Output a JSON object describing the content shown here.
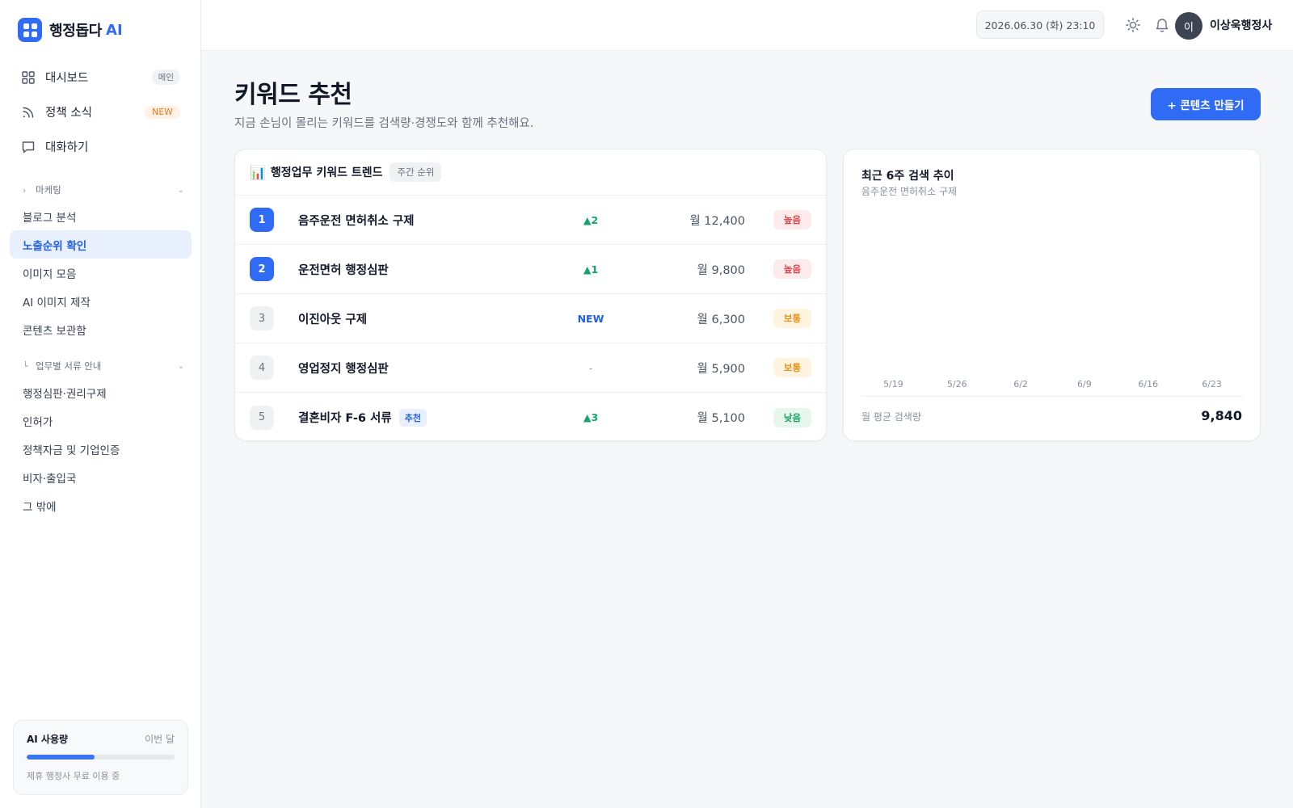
{
  "brand": {
    "name": "행정돕다",
    "ai": "AI"
  },
  "nav": {
    "dashboard": {
      "label": "대시보드",
      "badge": "메인"
    },
    "policy_news": {
      "label": "정책 소식",
      "badge": "NEW"
    },
    "chat": {
      "label": "대화하기"
    }
  },
  "marketing": {
    "title": "마케팅",
    "items": [
      {
        "label": "블로그 분석"
      },
      {
        "label": "노출순위 확인"
      },
      {
        "label": "이미지 모음"
      },
      {
        "label": "AI 이미지 제작"
      },
      {
        "label": "콘텐츠 보관함"
      }
    ]
  },
  "guides": {
    "title": "업무별 서류 안내",
    "items": [
      {
        "label": "행정심판·권리구제"
      },
      {
        "label": "인허가"
      },
      {
        "label": "정책자금 및 기업인증"
      },
      {
        "label": "비자·출입국"
      },
      {
        "label": "그 밖에"
      }
    ]
  },
  "usage": {
    "title": "AI 사용량",
    "period": "이번 달",
    "progress": 0.46,
    "note": "제휴 행정사 무료 이용 중"
  },
  "topbar": {
    "datetime": "2026.06.30 (화) 23:10",
    "avatar_initial": "이",
    "username": "이상욱행정사"
  },
  "page": {
    "title": "키워드 추천",
    "subtitle": "지금 손님이 몰리는 키워드를 검색량·경쟁도와 함께 추천해요.",
    "create_button": "+ 콘텐츠 만들기"
  },
  "trend": {
    "icon": "📊",
    "title": "행정업무 키워드 트렌드",
    "tag": "주간 순위",
    "rows": [
      {
        "rank": "1",
        "keyword": "음주운전 면허취소 구제",
        "tag": "",
        "change": "▲2",
        "volume": "월 12,400",
        "competition": "높음"
      },
      {
        "rank": "2",
        "keyword": "운전면허 행정심판",
        "tag": "",
        "change": "▲1",
        "volume": "월 9,800",
        "competition": "높음"
      },
      {
        "rank": "3",
        "keyword": "이진아웃 구제",
        "tag": "",
        "change": "NEW",
        "volume": "월 6,300",
        "competition": "보통"
      },
      {
        "rank": "4",
        "keyword": "영업정지 행정심판",
        "tag": "",
        "change": "-",
        "volume": "월 5,900",
        "competition": "보통"
      },
      {
        "rank": "5",
        "keyword": "결혼비자 F-6 서류",
        "tag": "추천",
        "change": "▲3",
        "volume": "월 5,100",
        "competition": "낮음"
      }
    ]
  },
  "search_trend": {
    "title": "최근 6주 검색 추이",
    "subtitle": "음주운전 면허취소 구제",
    "weeks": [
      "5/19",
      "5/26",
      "6/2",
      "6/9",
      "6/16",
      "6/23"
    ],
    "avg_label": "월 평균 검색량",
    "avg_value": "9,840"
  },
  "colors": {
    "accent": "#2f6bf5",
    "active_bg": "#e8effd",
    "high": "#e0434b",
    "mid": "#e8911b",
    "low": "#1ea463",
    "new_badge": "#e8791b"
  }
}
